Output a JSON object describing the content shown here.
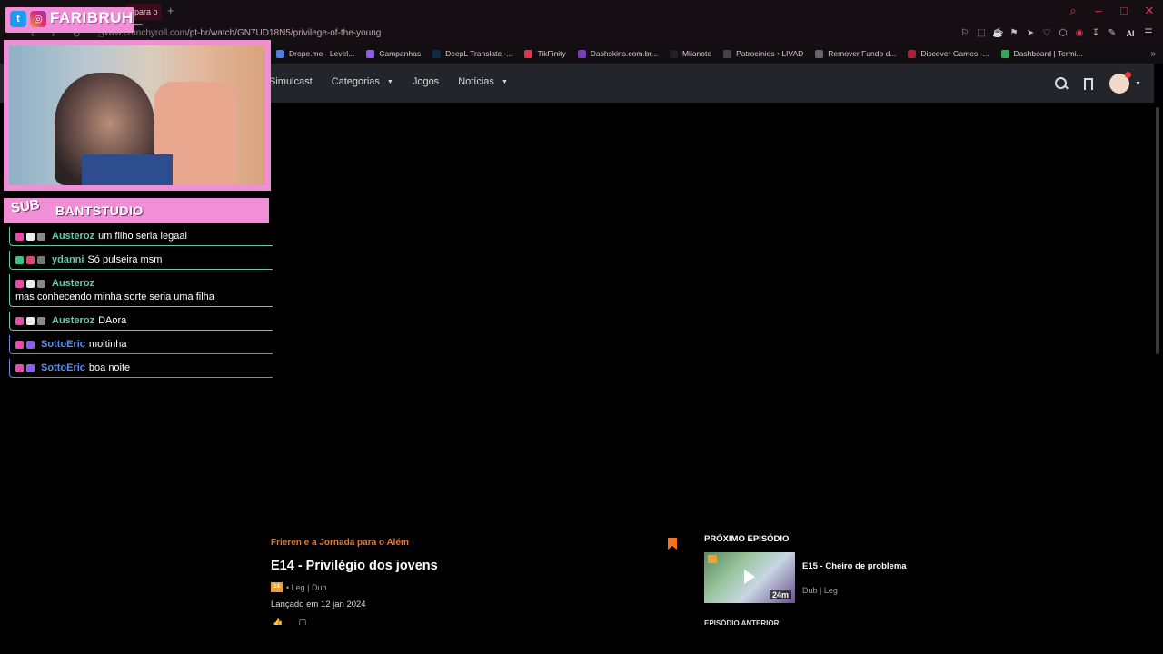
{
  "browser": {
    "active_tab_fragment": "para o",
    "new_tab_symbol": "+",
    "url_domain": "www.crunchyroll.com",
    "url_path": "/pt-br/watch/GN7UD18N5/privilege-of-the-young",
    "window_controls": [
      "⌕",
      "–",
      "□",
      "✕"
    ],
    "extensions": [
      "⚐",
      "⬚",
      "☕",
      "⚑",
      "➤",
      "♡",
      "⬡",
      "◉",
      "↧",
      "✎"
    ],
    "ai_label": "AI",
    "menu_symbol": "☰"
  },
  "bookmarks": [
    {
      "label": "Drope.me - Level...",
      "color": "#4f7fe0"
    },
    {
      "label": "Campanhas",
      "color": "#8a5cf0"
    },
    {
      "label": "DeepL Translate -...",
      "color": "#0f2b46"
    },
    {
      "label": "TikFinity",
      "color": "#e0364f"
    },
    {
      "label": "Dashskins.com.br...",
      "color": "#7a3fb8"
    },
    {
      "label": "Milanote",
      "color": "#222222"
    },
    {
      "label": "Patrocínios • LIVAD",
      "color": "#444444"
    },
    {
      "label": "Remover Fundo d...",
      "color": "#666666"
    },
    {
      "label": "Discover Games -...",
      "color": "#b01e3c"
    },
    {
      "label": "Dashboard | Termi...",
      "color": "#3aa55a"
    }
  ],
  "site": {
    "nav": [
      {
        "label": "Simulcast",
        "dropdown": false
      },
      {
        "label": "Categorias",
        "dropdown": true
      },
      {
        "label": "Jogos",
        "dropdown": false
      },
      {
        "label": "Notícias",
        "dropdown": true
      }
    ]
  },
  "episode": {
    "series": "Frieren e a Jornada para o Além",
    "title": "E14 - Privilégio dos jovens",
    "rating": "14",
    "audio": "• Leg | Dub",
    "release": "Lançado em 12 jan 2024"
  },
  "next_episode": {
    "heading": "PRÓXIMO EPISÓDIO",
    "title": "E15 - Cheiro de problema",
    "meta": "Dub | Leg",
    "duration": "24m",
    "cut_heading": "EPISÓDIO ANTERIOR"
  },
  "overlay": {
    "handle": "FARIBRUH_",
    "sub_tag": "SUB",
    "sub_name": "BANTSTUDIO",
    "chat": [
      {
        "user": "Austeroz",
        "text": "um filho seria legaal",
        "user_color": "#6bc6a8",
        "style": "green",
        "badges": [
          "#e84aa8",
          "#eeeeee",
          "#888888"
        ]
      },
      {
        "user": "ydanni",
        "text": "Só pulseira msm",
        "user_color": "#6bc6a8",
        "style": "green",
        "badges": [
          "#3cc27a",
          "#d94a7a",
          "#777777"
        ]
      },
      {
        "user": "Austeroz",
        "text": "",
        "continuation": "mas conhecendo minha sorte seria uma filha",
        "user_color": "#6bc6a8",
        "style": "green",
        "badges": [
          "#e84aa8",
          "#eeeeee",
          "#888888"
        ]
      },
      {
        "user": "Austeroz",
        "text": "DAora",
        "user_color": "#6bc6a8",
        "style": "green",
        "badges": [
          "#e84aa8",
          "#eeeeee",
          "#888888"
        ]
      },
      {
        "user": "SottoEric",
        "text": "moitinha",
        "user_color": "#5c8fe8",
        "style": "blue",
        "badges": [
          "#e84aa8",
          "#8a5cf0"
        ]
      },
      {
        "user": "SottoEric",
        "text": "boa noite",
        "user_color": "#5c8fe8",
        "style": "blue",
        "badges": [
          "#e84aa8",
          "#8a5cf0"
        ]
      }
    ]
  }
}
